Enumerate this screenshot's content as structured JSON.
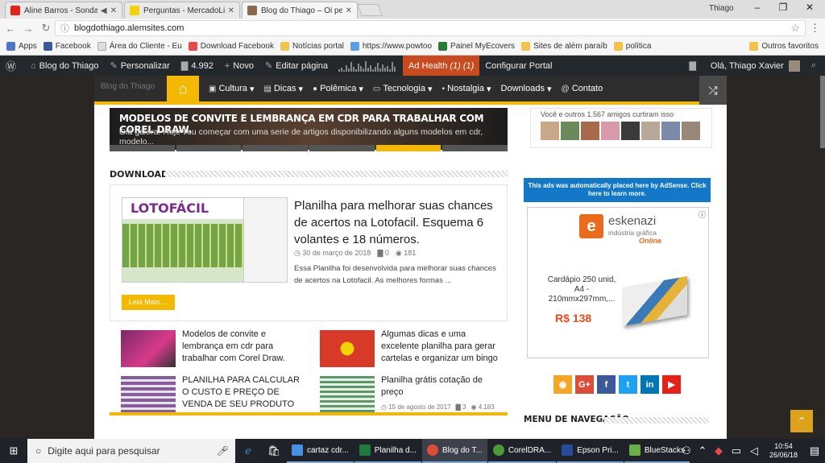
{
  "browser": {
    "tabs": [
      {
        "label": "Aline Barros - Sonda-",
        "icon_color": "#e62117"
      },
      {
        "label": "Perguntas - MercadoLivre",
        "icon_color": "#f5d300"
      },
      {
        "label": "Blog do Thiago – Oi pess",
        "icon_color": "#8a6a4a"
      }
    ],
    "window_user": "Thiago",
    "window_controls": [
      "–",
      "❐",
      "✕"
    ],
    "url": "blogdothiago.alemsites.com"
  },
  "bookmarks": {
    "items": [
      {
        "label": "Apps",
        "icon_color": "#4a78c8"
      },
      {
        "label": "Facebook",
        "icon_color": "#3b5998"
      },
      {
        "label": "Área do Cliente - Eu",
        "icon_color": "#dddddd"
      },
      {
        "label": "Download Facebook",
        "icon_color": "#e84a4a"
      },
      {
        "label": "Notícias portal",
        "icon_color": "#f0c54a"
      },
      {
        "label": "https://www.powtoo",
        "icon_color": "#5aa0e0"
      },
      {
        "label": "Painel MyEcovers",
        "icon_color": "#2a7a3a"
      },
      {
        "label": "Sites de além paraíb",
        "icon_color": "#f0c54a"
      },
      {
        "label": "política",
        "icon_color": "#f0c54a"
      }
    ],
    "other": "Outros favoritos"
  },
  "wpbar": {
    "site_name": "Blog do Thiago",
    "customize": "Personalizar",
    "comments": "4.992",
    "new": "Novo",
    "edit": "Editar página",
    "ad_health": "Ad Health",
    "ad_health_count": "(1) (1)",
    "config": "Configurar Portal",
    "greeting": "Olá, Thiago Xavier"
  },
  "site": {
    "logo_alt": "Blog do Thiago",
    "nav": [
      "Cultura",
      "Dicas",
      "Polêmica",
      "Tecnologia",
      "Nostalgia",
      "Downloads",
      "Contato"
    ],
    "slider": {
      "title": "MODELOS DE CONVITE E LEMBRANÇA EM CDR PARA TRABALHAR COM COREL DRAW.",
      "excerpt": "Olá galera! Hoje vou começar com uma serie de artigos disponibilizando alguns modelos em cdr, modelo..."
    },
    "section_title": "DOWNLOADS",
    "featured": {
      "thumb_logo": "LOTOFÁCIL",
      "title": "Planilha para melhorar suas chances de acertos na Lotofacil. Esquema 6 volantes e 18 números.",
      "date": "30 de março de 2018",
      "comments": "0",
      "views": "181",
      "excerpt": "Essa Planilha foi desenvolvida para melhorar suas chances de acertos na Lotofacil. As melhores formas ...",
      "read_more": "Leia Mais...."
    },
    "posts": [
      {
        "title": "Modelos de convite e lembrança em cdr para trabalhar com Corel Draw.",
        "thumb_color": "#7a2a6a",
        "date": "",
        "comments": "",
        "views": ""
      },
      {
        "title": "Algumas dicas e uma excelente planilha para gerar cartelas e organizar um bingo",
        "thumb_color": "#d83a2a",
        "date": "",
        "comments": "",
        "views": ""
      },
      {
        "title": "PLANILHA PARA CALCULAR O CUSTO E PREÇO DE VENDA DE SEU PRODUTO",
        "thumb_color": "#8a5aa0",
        "date": "",
        "comments": "",
        "views": ""
      },
      {
        "title": "Planilha grátis cotação de preço",
        "thumb_color": "#5a9a6a",
        "date": "15 de agosto de 2017",
        "comments": "3",
        "views": "4.183"
      }
    ]
  },
  "sidebar": {
    "like_text": "Você e outros 1.567 amigos curtiram isso",
    "adsense_note": "This ads was automatically placed here by AdSense. Click here to learn more.",
    "ad": {
      "logo_letter": "e",
      "brand": "eskenazi",
      "sub": "indústria gráfica",
      "online": "Online",
      "text": "Cardápio 250 unid, A4 - 210mmx297mm,...",
      "price": "R$ 138"
    },
    "social": [
      {
        "icon": "rss-icon",
        "glyph": "◉",
        "color": "#f5a623"
      },
      {
        "icon": "googleplus-icon",
        "glyph": "G+",
        "color": "#dd4b39"
      },
      {
        "icon": "facebook-icon",
        "glyph": "f",
        "color": "#3b5998"
      },
      {
        "icon": "twitter-icon",
        "glyph": "t",
        "color": "#1da1f2"
      },
      {
        "icon": "linkedin-icon",
        "glyph": "in",
        "color": "#0077b5"
      },
      {
        "icon": "youtube-icon",
        "glyph": "▶",
        "color": "#e62117"
      }
    ],
    "nav_menu_title": "MENU DE NAVEGAÇÃO"
  },
  "taskbar": {
    "search_placeholder": "Digite aqui para pesquisar",
    "apps": [
      {
        "label": "cartaz cdr...",
        "icon_color": "#4a90e2"
      },
      {
        "label": "Planilha d...",
        "icon_color": "#1f7a3f"
      },
      {
        "label": "Blog do T...",
        "icon_color": "#dd4b39"
      },
      {
        "label": "CorelDRA...",
        "icon_color": "#4a9a3a"
      },
      {
        "label": "Epson Pri...",
        "icon_color": "#2a4a9a"
      },
      {
        "label": "BlueStacks",
        "icon_color": "#6ab04a"
      }
    ],
    "time": "10:54",
    "date": "26/06/18"
  }
}
